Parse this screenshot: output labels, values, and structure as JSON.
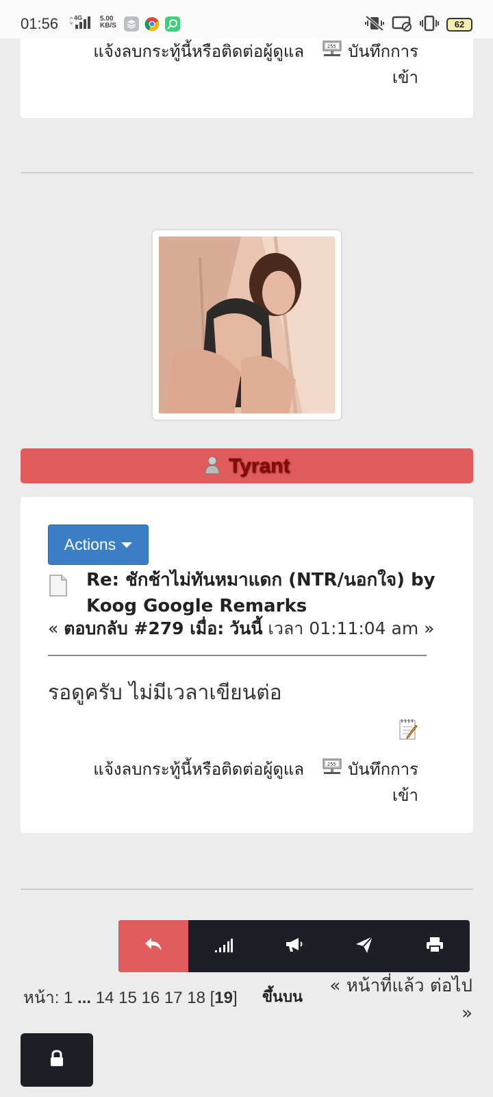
{
  "status_bar": {
    "time": "01:56",
    "net_type": "4G",
    "speed_value": "5.00",
    "speed_unit": "KB/S",
    "battery": "62"
  },
  "top_card": {
    "report_link": "แจ้งลบกระทู้นี้หรือติดต่อผู้ดูแล",
    "log_link_line1": "บันทึกการ",
    "log_link_line2": "เข้า"
  },
  "post": {
    "author": "Tyrant",
    "actions_label": "Actions",
    "title_line1": "Re: ชักช้าไม่ทันหมาแดก (NTR/นอกใจ) by",
    "title_line2": "Koog Google Remarks",
    "meta_open": "«",
    "meta_reply": "ตอบกลับ #279 เมื่อ:",
    "meta_day": "วันนี้",
    "meta_time": "เวลา 01:11:04 am",
    "meta_close": "»",
    "body": "รอดูครับ ไม่มีเวลาเขียนต่อ",
    "report_link": "แจ้งลบกระทู้นี้หรือติดต่อผู้ดูแล",
    "log_link_line1": "บันทึกการ",
    "log_link_line2": "เข้า"
  },
  "toolbar": {
    "icons": [
      "reply-icon",
      "signal-icon",
      "megaphone-icon",
      "send-icon",
      "print-icon"
    ],
    "accent": "#e05c5c",
    "dark": "#1c1f26"
  },
  "pagination": {
    "label": "หน้า:",
    "pages_start": "1",
    "ellipsis": "...",
    "pages_mid": "14 15 16 17 18",
    "current": "19",
    "goto_top": "ขึ้นบน",
    "prev_next": "« หน้าที่แล้ว ต่อไป",
    "next_arrow": "»"
  }
}
